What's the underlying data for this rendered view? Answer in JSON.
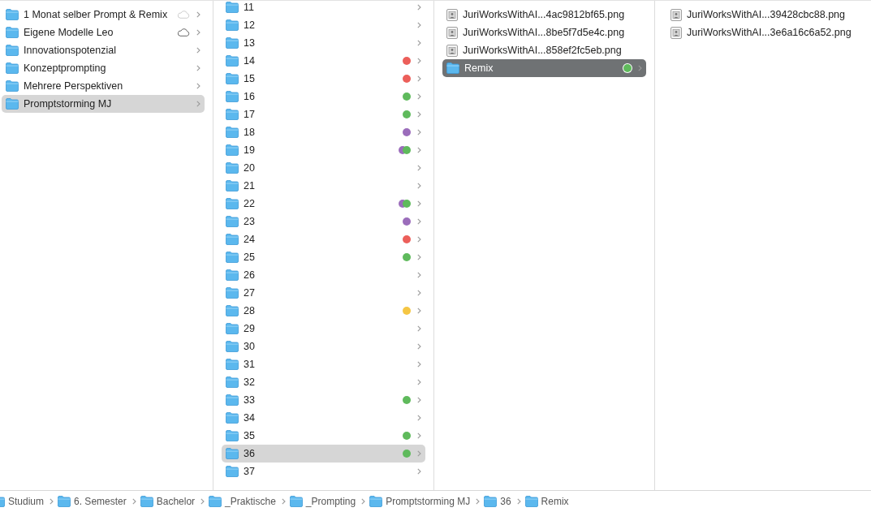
{
  "columns": [
    {
      "items": [
        {
          "kind": "folder",
          "name": "1 Monat selber Prompt & Remix",
          "selected": false,
          "cloud_synced": false
        },
        {
          "kind": "folder",
          "name": "Eigene Modelle Leo",
          "selected": false,
          "cloud_synced": true
        },
        {
          "kind": "folder",
          "name": "Innovationspotenzial",
          "selected": false
        },
        {
          "kind": "folder",
          "name": "Konzeptprompting",
          "selected": false
        },
        {
          "kind": "folder",
          "name": "Mehrere Perspektiven",
          "selected": false
        },
        {
          "kind": "folder",
          "name": "Promptstorming MJ",
          "selected": true
        }
      ]
    },
    {
      "items": [
        {
          "kind": "folder",
          "name": "11",
          "selected": false
        },
        {
          "kind": "folder",
          "name": "12",
          "selected": false
        },
        {
          "kind": "folder",
          "name": "13",
          "selected": false
        },
        {
          "kind": "folder",
          "name": "14",
          "selected": false,
          "tags": [
            {
              "color": "#ec5f5a"
            }
          ]
        },
        {
          "kind": "folder",
          "name": "15",
          "selected": false,
          "tags": [
            {
              "color": "#ec5f5a"
            }
          ]
        },
        {
          "kind": "folder",
          "name": "16",
          "selected": false,
          "tags": [
            {
              "color": "#5fba5c"
            }
          ]
        },
        {
          "kind": "folder",
          "name": "17",
          "selected": false,
          "tags": [
            {
              "color": "#5fba5c"
            }
          ]
        },
        {
          "kind": "folder",
          "name": "18",
          "selected": false,
          "tags": [
            {
              "color": "#9b6dbb"
            }
          ]
        },
        {
          "kind": "folder",
          "name": "19",
          "selected": false,
          "tags": [
            {
              "color": "#5fba5c"
            },
            {
              "color": "#9b6dbb"
            }
          ]
        },
        {
          "kind": "folder",
          "name": "20",
          "selected": false
        },
        {
          "kind": "folder",
          "name": "21",
          "selected": false
        },
        {
          "kind": "folder",
          "name": "22",
          "selected": false,
          "tags": [
            {
              "color": "#5fba5c"
            },
            {
              "color": "#9b6dbb"
            }
          ]
        },
        {
          "kind": "folder",
          "name": "23",
          "selected": false,
          "tags": [
            {
              "color": "#9b6dbb"
            }
          ]
        },
        {
          "kind": "folder",
          "name": "24",
          "selected": false,
          "tags": [
            {
              "color": "#ec5f5a"
            }
          ]
        },
        {
          "kind": "folder",
          "name": "25",
          "selected": false,
          "tags": [
            {
              "color": "#5fba5c"
            }
          ]
        },
        {
          "kind": "folder",
          "name": "26",
          "selected": false
        },
        {
          "kind": "folder",
          "name": "27",
          "selected": false
        },
        {
          "kind": "folder",
          "name": "28",
          "selected": false,
          "tags": [
            {
              "color": "#f5c644"
            }
          ]
        },
        {
          "kind": "folder",
          "name": "29",
          "selected": false
        },
        {
          "kind": "folder",
          "name": "30",
          "selected": false
        },
        {
          "kind": "folder",
          "name": "31",
          "selected": false
        },
        {
          "kind": "folder",
          "name": "32",
          "selected": false
        },
        {
          "kind": "folder",
          "name": "33",
          "selected": false,
          "tags": [
            {
              "color": "#5fba5c"
            }
          ]
        },
        {
          "kind": "folder",
          "name": "34",
          "selected": false
        },
        {
          "kind": "folder",
          "name": "35",
          "selected": false,
          "tags": [
            {
              "color": "#5fba5c"
            }
          ]
        },
        {
          "kind": "folder",
          "name": "36",
          "selected": true,
          "tags": [
            {
              "color": "#5fba5c"
            }
          ]
        },
        {
          "kind": "folder",
          "name": "37",
          "selected": false
        }
      ]
    },
    {
      "focused": true,
      "items": [
        {
          "kind": "image",
          "name": "JuriWorksWithAI...4ac9812bf65.png",
          "selected": false
        },
        {
          "kind": "image",
          "name": "JuriWorksWithAI...8be5f7d5e4c.png",
          "selected": false
        },
        {
          "kind": "image",
          "name": "JuriWorksWithAI...858ef2fc5eb.png",
          "selected": false
        },
        {
          "kind": "folder",
          "name": "Remix",
          "selected": true,
          "tags": [
            {
              "color": "#5fba5c"
            }
          ]
        }
      ]
    },
    {
      "items": [
        {
          "kind": "image",
          "name": "JuriWorksWithAI...39428cbc88.png",
          "selected": false
        },
        {
          "kind": "image",
          "name": "JuriWorksWithAI...3e6a16c6a52.png",
          "selected": false
        }
      ]
    }
  ],
  "path_bar": [
    {
      "label": "Studium"
    },
    {
      "label": "6. Semester"
    },
    {
      "label": "Bachelor"
    },
    {
      "label": "_Praktische"
    },
    {
      "label": "_Prompting"
    },
    {
      "label": "Promptstorming MJ"
    },
    {
      "label": "36"
    },
    {
      "label": "Remix"
    }
  ]
}
